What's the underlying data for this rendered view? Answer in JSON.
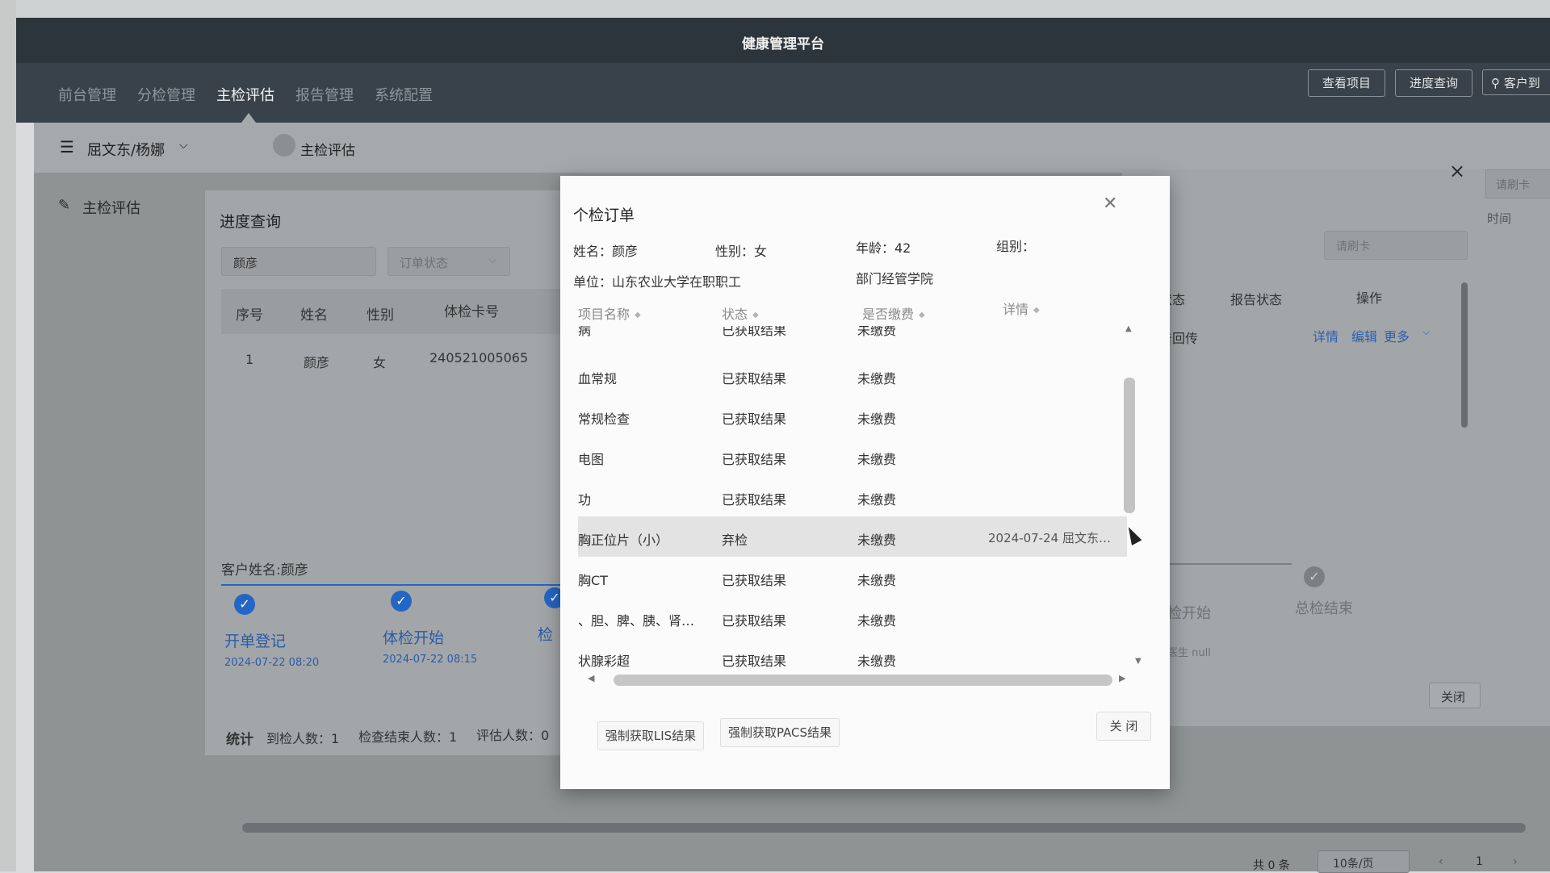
{
  "app": {
    "title": "健康管理平台"
  },
  "nav": {
    "items": [
      "前台管理",
      "分检管理",
      "主检评估",
      "报告管理",
      "系统配置"
    ],
    "header_buttons": [
      "查看项目",
      "进度查询",
      "客户到"
    ]
  },
  "subbar": {
    "user": "屈文东/杨娜",
    "tab": "主检评估"
  },
  "sidebar": {
    "item": "主检评估"
  },
  "progress_panel": {
    "title": "进度查询",
    "search_value": "颜彦",
    "status_placeholder": "订单状态",
    "columns": [
      "序号",
      "姓名",
      "性别",
      "体检卡号"
    ],
    "rows": [
      {
        "no": "1",
        "name": "颜彦",
        "gender": "女",
        "card": "240521005065"
      }
    ],
    "customer_label": "客户姓名:颜彦",
    "steps": [
      {
        "label": "开单登记",
        "time": "2024-07-22 08:20"
      },
      {
        "label": "体检开始",
        "time": "2024-07-22 08:15"
      },
      {
        "label": "检"
      }
    ],
    "stats": {
      "title": "统计",
      "arrived": "到检人数：1",
      "finished": "检查结束人数：1",
      "evaluated": "评估人数：0"
    }
  },
  "right_panel": {
    "swipe_btn": "请刷卡",
    "time_col": "时间",
    "swipe_input_placeholder": "请刷卡",
    "columns": [
      "状态",
      "报告状态",
      "操作"
    ],
    "row_status": "告回传",
    "actions": {
      "detail": "详情",
      "edit": "编辑",
      "more": "更多"
    },
    "step_start": "检开始",
    "step_end": "总检结束",
    "doctor": "医生 null",
    "close_btn": "关闭"
  },
  "pagination": {
    "total": "共 0 条",
    "per_page": "10条/页",
    "page": "1"
  },
  "dialog": {
    "title": "个检订单",
    "close_icon": "close-icon",
    "info": {
      "name": "姓名：颜彦",
      "gender": "性别：女",
      "age": "年龄：42",
      "group": "组别：",
      "unit": "单位：山东农业大学在职职工",
      "dept": "部门经管学院"
    },
    "columns": [
      "项目名称",
      "状态",
      "是否缴费",
      "详情"
    ],
    "rows": [
      {
        "name": "病",
        "status": "已获取结果",
        "paid": "未缴费",
        "detail": ""
      },
      {
        "name": "血常规",
        "status": "已获取结果",
        "paid": "未缴费",
        "detail": ""
      },
      {
        "name": "常规检查",
        "status": "已获取结果",
        "paid": "未缴费",
        "detail": ""
      },
      {
        "name": "电图",
        "status": "已获取结果",
        "paid": "未缴费",
        "detail": ""
      },
      {
        "name": "功",
        "status": "已获取结果",
        "paid": "未缴费",
        "detail": ""
      },
      {
        "name": "胸正位片（小）",
        "status": "弃检",
        "paid": "未缴费",
        "detail": "2024-07-24 屈文东…"
      },
      {
        "name": "胸CT",
        "status": "已获取结果",
        "paid": "未缴费",
        "detail": ""
      },
      {
        "name": "、胆、脾、胰、肾…",
        "status": "已获取结果",
        "paid": "未缴费",
        "detail": ""
      },
      {
        "name": "状腺彩超",
        "status": "已获取结果",
        "paid": "未缴费",
        "detail": ""
      }
    ],
    "buttons": {
      "lis": "强制获取LIS结果",
      "pacs": "强制获取PACS结果",
      "close": "关 闭"
    }
  }
}
